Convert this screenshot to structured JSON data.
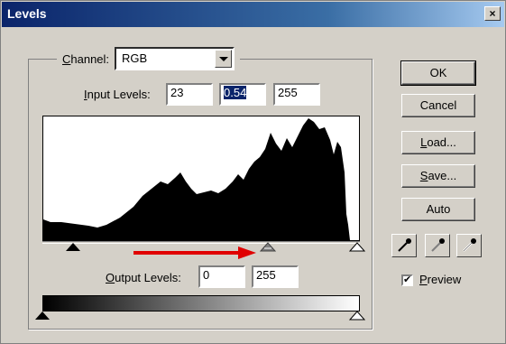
{
  "window": {
    "title": "Levels",
    "close_label": "×"
  },
  "channel": {
    "label_u": "C",
    "label_rest": "hannel:",
    "value": "RGB"
  },
  "input_levels": {
    "label_u": "I",
    "label_rest": "nput Levels:",
    "black": "23",
    "gamma": "0.54",
    "white": "255"
  },
  "output_levels": {
    "label_u": "O",
    "label_rest": "utput Levels:",
    "black": "0",
    "white": "255"
  },
  "buttons": {
    "ok": "OK",
    "cancel": "Cancel",
    "load_u": "L",
    "load_rest": "oad...",
    "save_u": "S",
    "save_rest": "ave...",
    "auto": "Auto"
  },
  "preview": {
    "label_u": "P",
    "label_rest": "review",
    "checked": true
  },
  "eyedroppers": [
    "black-eyedropper-icon",
    "gray-eyedropper-icon",
    "white-eyedropper-icon"
  ],
  "colors": {
    "annotation_arrow": "#e00000",
    "title_bar": "#0a246a"
  }
}
